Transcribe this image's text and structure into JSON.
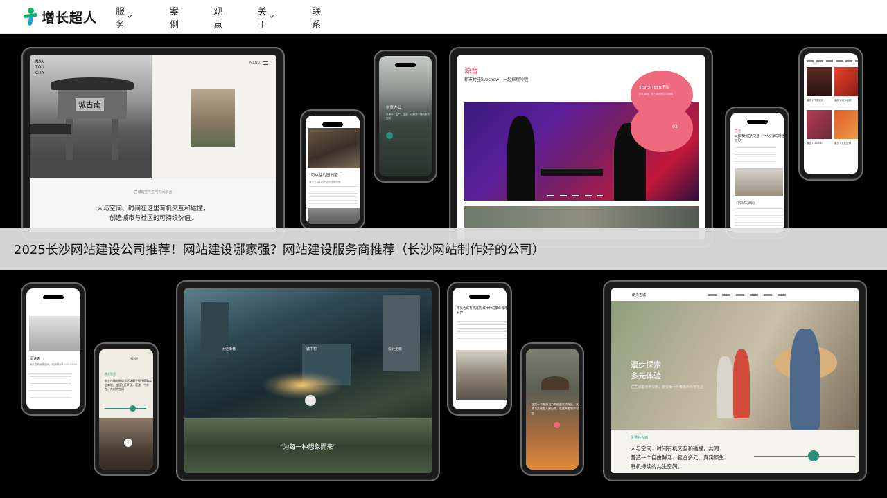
{
  "header": {
    "logo_text": "增长超人",
    "nav": [
      {
        "label": "服务",
        "has_dropdown": true
      },
      {
        "label": "案例",
        "has_dropdown": false
      },
      {
        "label": "观点",
        "has_dropdown": false
      },
      {
        "label": "关于",
        "has_dropdown": true
      },
      {
        "label": "联系",
        "has_dropdown": false
      }
    ]
  },
  "colors": {
    "brand_green": "#19b06b",
    "brand_blue": "#1aa2d6",
    "pink": "#f06a7f",
    "teal": "#2d8f7e"
  },
  "banner": {
    "title": "2025长沙网站建设公司推荐！网站建设哪家强？网站建设服务商推荐（长沙网站制作好的公司）"
  },
  "showcase": {
    "t1": {
      "logo": "NAN TOU CITY",
      "menu": "MENU",
      "gate_sign": "城古南",
      "subtitle": "古城的空今生与时间融合",
      "headline_1": "人与空间、时间在这里有机交互和碰撞，",
      "headline_2": "创造城市与社区的可持续价值。"
    },
    "p1": {
      "heading": "“可以住的图书馆”",
      "body": "南头古城中的书店与住宿空间"
    },
    "p2": {
      "heading": "创意办公",
      "body": "以美学、生产、生活、社群为一体的多元空间"
    },
    "t2": {
      "title": "源音",
      "subtitle": "都市村庄liveshow，一起探摆吟唱",
      "circle_label": "SEVENTEEN乐队",
      "circle_sub": "乐队演唱，在古城的夜空中回响",
      "page": "02"
    },
    "p3": {
      "tag": "游活",
      "heading": "以都市村庄为话题 - 个人分享与时话讨论",
      "caption": "《南头与深圳》"
    },
    "p4": {
      "cards": [
        "潘统十下的文化",
        "潘统1  南头古城",
        "展览 I LLUSBO",
        "展览 I 文化空间"
      ]
    },
    "p5": {
      "heading": "阅读馆",
      "body": "南头古城阅读空间，开放时间 10:00-20:00"
    },
    "p6": {
      "menu": "MENU",
      "tag": "南头生活",
      "heading": "南头古城的街道与活化展于居住区和商业实验，连接社区环境，营造一个亦在、共创的空间"
    },
    "t3": {
      "label_1": "历史街巷",
      "label_2": "城中村",
      "label_3": "设计更新",
      "quote": "“为每一种想象而来”"
    },
    "p7": {
      "heading": "南头古城有熊酒店 城中村与繁华都市共存"
    },
    "p8": {
      "heading": "这是一个充满活力的创意生活社区，艺术与文化融入到日常，在此共看城市发生"
    },
    "t4": {
      "logo": "南头古城",
      "headline_1": "漫步探索",
      "headline_2": "多元体验",
      "sub": "在古城里漫步探索，感受每一个角落的日常生活",
      "tag": "生活在古城",
      "body_1": "人与空间、时间有机交互和碰撞，共同",
      "body_2": "营造一个自由鲜活、复合多元、真实原生、",
      "body_3": "有机持续的共生空间。"
    }
  }
}
